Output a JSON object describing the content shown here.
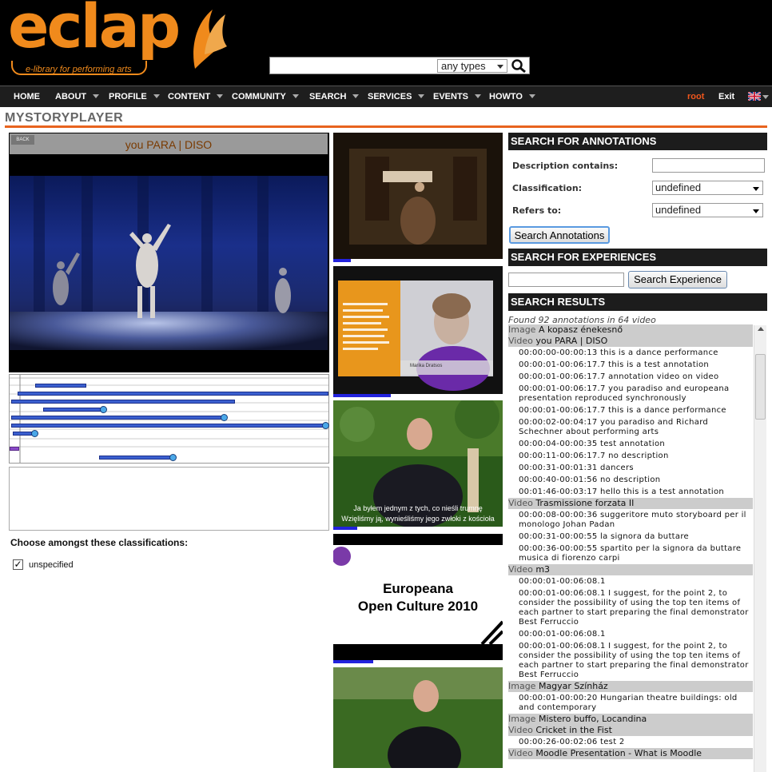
{
  "logo": {
    "word": "eclap",
    "tagline": "e-library for performing arts"
  },
  "search": {
    "value": "",
    "type_selected": "any types"
  },
  "nav": {
    "items": [
      "HOME",
      "ABOUT",
      "PROFILE",
      "CONTENT",
      "COMMUNITY",
      "SEARCH",
      "SERVICES",
      "EVENTS",
      "HOWTO"
    ],
    "user": "root",
    "exit": "Exit"
  },
  "page_title": "MYSTORYPLAYER",
  "player": {
    "title": "you PARA | DISO",
    "back_label": "BACK"
  },
  "classifications": {
    "title": "Choose amongst these classifications:",
    "options": [
      {
        "label": "unspecified",
        "checked": true
      }
    ]
  },
  "thumbnails": {
    "subtitle_lines": [
      "Ja byłem jednym z tych, co nieśli trumnę",
      "Wzięliśmy ją, wynieśliśmy jego zwłoki z kościoła"
    ],
    "europeana_lines": [
      "Europeana",
      "Open Culture 2010"
    ],
    "slide_caption": "Marika Dratsos"
  },
  "annotation_search": {
    "header": "SEARCH FOR ANNOTATIONS",
    "description_label": "Description contains:",
    "description_value": "",
    "classification_label": "Classification:",
    "classification_value": "undefined",
    "refers_label": "Refers to:",
    "refers_value": "undefined",
    "button": "Search Annotations"
  },
  "experience_search": {
    "header": "SEARCH FOR EXPERIENCES",
    "value": "",
    "button": "Search Experience"
  },
  "results": {
    "header": "SEARCH RESULTS",
    "summary": "Found 92 annotations in 64 video",
    "groups": [
      {
        "kind": "Image",
        "title": "A kopasz énekesnő",
        "items": []
      },
      {
        "kind": "Video",
        "title": "you PARA | DISO",
        "items": [
          "00:00:00-00:00:13 this is a dance performance",
          "00:00:01-00:06:17.7 this is a test annotation",
          "00:00:01-00:06:17.7 annotation video on video",
          "00:00:01-00:06:17.7 you paradiso and europeana presentation reproduced synchronously",
          "00:00:01-00:06:17.7 this is a dance performance",
          "00:00:02-00:04:17 you paradiso and Richard Schechner about performing arts",
          "00:00:04-00:00:35 test annotation",
          "00:00:11-00:06:17.7 no description",
          "00:00:31-00:01:31 dancers",
          "00:00:40-00:01:56 no description",
          "00:01:46-00:03:17 hello this is a test annotation"
        ]
      },
      {
        "kind": "Video",
        "title": "Trasmissione forzata II",
        "items": [
          "00:00:08-00:00:36 suggeritore muto storyboard per il monologo Johan Padan",
          "00:00:31-00:00:55 la signora da buttare",
          "00:00:36-00:00:55 spartito per la signora da buttare musica di fiorenzo carpi"
        ]
      },
      {
        "kind": "Video",
        "title": "m3",
        "items": [
          "00:00:01-00:06:08.1",
          "00:00:01-00:06:08.1 I suggest, for the point 2, to consider the possibility of using the top ten items of each partner to start preparing the final demonstrator Best Ferruccio",
          "00:00:01-00:06:08.1",
          "00:00:01-00:06:08.1 I suggest, for the point 2, to consider the possibility of using the top ten items of each partner to start preparing the final demonstrator Best Ferruccio"
        ]
      },
      {
        "kind": "Image",
        "title": "Magyar Színház",
        "items": [
          "00:00:01-00:00:20 Hungarian theatre buildings: old and contemporary"
        ]
      },
      {
        "kind": "Image",
        "title": "Mistero buffo, Locandina",
        "items": []
      },
      {
        "kind": "Video",
        "title": "Cricket in the Fist",
        "items": [
          "00:00:26-00:02:06 test 2"
        ]
      },
      {
        "kind": "Video",
        "title": "Moodle Presentation - What is Moodle",
        "items": []
      }
    ]
  },
  "colors": {
    "accent": "#e8631e",
    "logo": "#f08a1c",
    "nav_bg": "#1e1e1e",
    "section_bg": "#1c1c1c"
  }
}
